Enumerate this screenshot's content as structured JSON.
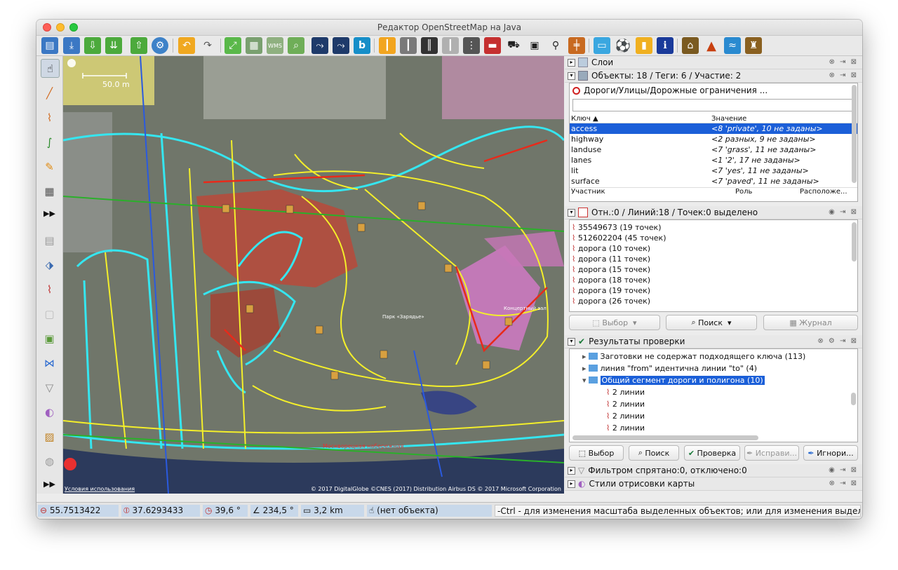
{
  "window": {
    "title": "Редактор OpenStreetMap на Java"
  },
  "colors": {
    "selection": "#1b5fd8",
    "status_field": "#c8d8ea",
    "road_cyan": "#35e6f0",
    "road_yellow": "#f4ef2a",
    "area_red": "#c84030",
    "area_pink": "#d978c8"
  },
  "toolbar": {
    "icons": [
      "open-file-icon",
      "open-location-icon",
      "download-icon",
      "download-along-icon",
      "upload-icon",
      "preferences-icon",
      "undo-icon",
      "redo-icon",
      "zoom-to-data-icon",
      "imagery-icon",
      "wms-icon",
      "search-zoom-icon",
      "route-icon",
      "route2-icon",
      "bing-icon",
      "road-yellow-icon",
      "road-grey-icon",
      "road-dark-icon",
      "road-light-icon",
      "traffic-signal-icon",
      "barrier-icon",
      "car-icon",
      "bus-icon",
      "bicycle-icon",
      "railway-icon",
      "hotel-icon",
      "football-icon",
      "shop-icon",
      "info-icon",
      "industrial-icon",
      "mountain-icon",
      "river-icon",
      "castle-icon"
    ]
  },
  "left_tools": [
    "select-tool-icon",
    "draw-line-icon",
    "draw-polyline-icon",
    "improve-way-icon",
    "pencil-icon",
    "building-icon",
    "more-tools-icon",
    "layers-stack-icon",
    "tag-icon",
    "way-select-icon",
    "validator-icon",
    "imagery-adjust-icon",
    "merge-icon",
    "filter-icon",
    "palette-icon",
    "map-paint-icon",
    "globe-icon",
    "more-tools-icon"
  ],
  "map": {
    "scale_label": "50.0 m",
    "credits": "© 2017 DigitalGlobe ©CNES (2017) Distribution Airbus DS © 2017 Microsoft Corporation",
    "terms": "Условия использования",
    "park_label": "Парк «Зарядье»",
    "hall_label": "Концертный зал",
    "street_label": "Москворецкая набережная"
  },
  "panels": {
    "layers": {
      "title": "Слои"
    },
    "properties": {
      "title": "Объекты: 18 / Теги: 6 / Участие: 2",
      "preset": "Дороги/Улицы/Дорожные ограничения ...",
      "col_key": "Ключ",
      "col_value": "Значение",
      "rows": [
        {
          "key": "access",
          "value": "<8 'private', 10 не заданы>"
        },
        {
          "key": "highway",
          "value": "<2 разных, 9 не заданы>"
        },
        {
          "key": "landuse",
          "value": "<7 'grass', 11 не заданы>"
        },
        {
          "key": "lanes",
          "value": "<1 '2', 17 не заданы>"
        },
        {
          "key": "lit",
          "value": "<7 'yes', 11 не заданы>"
        },
        {
          "key": "surface",
          "value": "<7 'paved', 11 не заданы>"
        }
      ],
      "member_col": "Участник",
      "role_col": "Роль",
      "position_col": "Расположе..."
    },
    "selection": {
      "title": "Отн.:0 / Линий:18 / Точек:0 выделено",
      "items": [
        "35549673 (19 точек)",
        "512602204 (45 точек)",
        "дорога (10 точек)",
        "дорога (11 точек)",
        "дорога (15 точек)",
        "дорога (18 точек)",
        "дорога (19 точек)",
        "дорога (26 точек)"
      ],
      "btn_select": "Выбор",
      "btn_search": "Поиск",
      "btn_history": "Журнал"
    },
    "validation": {
      "title": "Результаты проверки",
      "groups": [
        "Заготовки не содержат подходящего ключа (113)",
        "линия \"from\"  идентична линии \"to\" (4)",
        "Общий сегмент дороги и полигона (10)"
      ],
      "children": [
        "2 линии",
        "2 линии",
        "2 линии",
        "2 линии"
      ],
      "btn_select": "Выбор",
      "btn_search": "Поиск",
      "btn_check": "Проверка",
      "btn_fix": "Исправи...",
      "btn_ignore": "Игнори..."
    },
    "filter": {
      "title": "Фильтром спрятано:0, отключено:0"
    },
    "styles": {
      "title": "Стили отрисовки карты"
    }
  },
  "status": {
    "lat": "55.7513422",
    "lon": "37.6293433",
    "heading": "39,6 °",
    "angle": "234,5 °",
    "distance": "3,2 km",
    "object": "(нет объекта)",
    "help": "-Ctrl - для изменения масштаба выделенных объектов; или для изменения выделения"
  }
}
